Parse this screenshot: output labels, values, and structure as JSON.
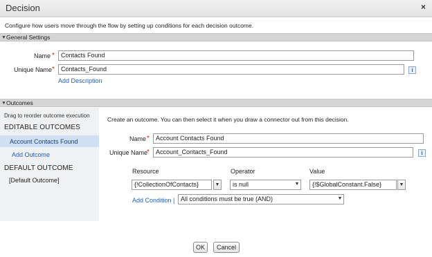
{
  "dialog": {
    "title": "Decision",
    "close_label": "×",
    "description": "Configure how users move through the flow by setting up conditions for each decision outcome."
  },
  "general": {
    "header": "General Settings",
    "name_label": "Name",
    "name_value": "Contacts Found",
    "unique_label": "Unique Name",
    "unique_value": "Contacts_Found",
    "add_description": "Add Description"
  },
  "outcomes": {
    "header": "Outcomes",
    "drag_hint": "Drag to reorder outcome execution",
    "editable_header": "EDITABLE OUTCOMES",
    "editable_items": [
      "Account Contacts Found"
    ],
    "add_outcome": "Add Outcome",
    "default_header": "DEFAULT OUTCOME",
    "default_item": "[Default Outcome]",
    "intro": "Create an outcome.  You can then select it when you draw a connector out from this decision.",
    "name_label": "Name",
    "name_value": "Account Contacts Found",
    "unique_label": "Unique Name",
    "unique_value": "Account_Contacts_Found",
    "condition": {
      "resource_header": "Resource",
      "operator_header": "Operator",
      "value_header": "Value",
      "resource_value": "{!CollectionOfContacts}",
      "operator_value": "is null",
      "value_value": "{!$GlobalConstant.False}"
    },
    "add_condition": "Add Condition |",
    "logic_value": "All conditions must be true (AND)"
  },
  "footer": {
    "ok_label": "OK",
    "cancel_label": "Cancel"
  },
  "icons": {
    "required": "*",
    "info": "i",
    "dropdown": "▼",
    "collapse": "▼"
  },
  "colors": {
    "link": "#1f5fbf",
    "required": "#cc1f1f",
    "selected_outcome": "#cfe0f2",
    "section_bar": "#d5d5d5"
  }
}
